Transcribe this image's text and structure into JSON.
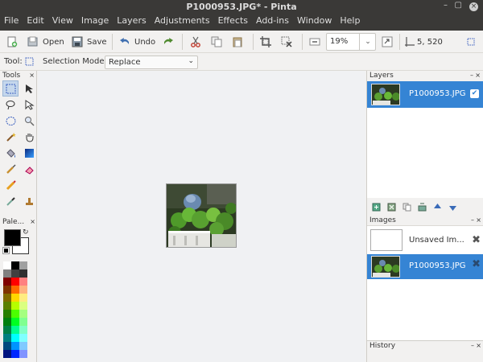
{
  "window": {
    "title": "P1000953.JPG* - Pinta"
  },
  "menu": [
    "File",
    "Edit",
    "View",
    "Image",
    "Layers",
    "Adjustments",
    "Effects",
    "Add-ins",
    "Window",
    "Help"
  ],
  "toolbar": {
    "open_label": "Open",
    "save_label": "Save",
    "undo_label": "Undo",
    "zoom_value": "19%",
    "cursor_position": "5, 520"
  },
  "toolbar2": {
    "tool_label": "Tool:",
    "selection_mode_label": "Selection Mode:",
    "selection_mode_value": "Replace"
  },
  "tools_panel": {
    "title": "Tools"
  },
  "palette_panel": {
    "title": "Pale...",
    "primary_color": "#000000",
    "secondary_color": "#ffffff",
    "colors": [
      "#ffffff",
      "#000000",
      "#a0a0a0",
      "#808080",
      "#404040",
      "#303030",
      "#7f0000",
      "#ff0000",
      "#ff8080",
      "#7f3300",
      "#ff6a00",
      "#ffb380",
      "#7f6a00",
      "#ffd800",
      "#ffec80",
      "#5b7f00",
      "#b6ff00",
      "#dbff80",
      "#267f00",
      "#4cff00",
      "#a5ff80",
      "#007f0e",
      "#00ff21",
      "#80ff90",
      "#007f46",
      "#00ff90",
      "#80ffc7",
      "#007f7f",
      "#00ffff",
      "#80ffff",
      "#004a7f",
      "#0094ff",
      "#80caff",
      "#00137f",
      "#0026ff",
      "#8093ff"
    ]
  },
  "layers_panel": {
    "title": "Layers",
    "layers": [
      {
        "name": "P1000953.JPG",
        "visible": true
      }
    ]
  },
  "images_panel": {
    "title": "Images",
    "images": [
      {
        "name": "Unsaved Im..."
      },
      {
        "name": "P1000953.JPG"
      }
    ]
  },
  "history_panel": {
    "title": "History"
  },
  "colors": {
    "selection_blue": "#3584d4",
    "titlebar": "#3a3937"
  }
}
